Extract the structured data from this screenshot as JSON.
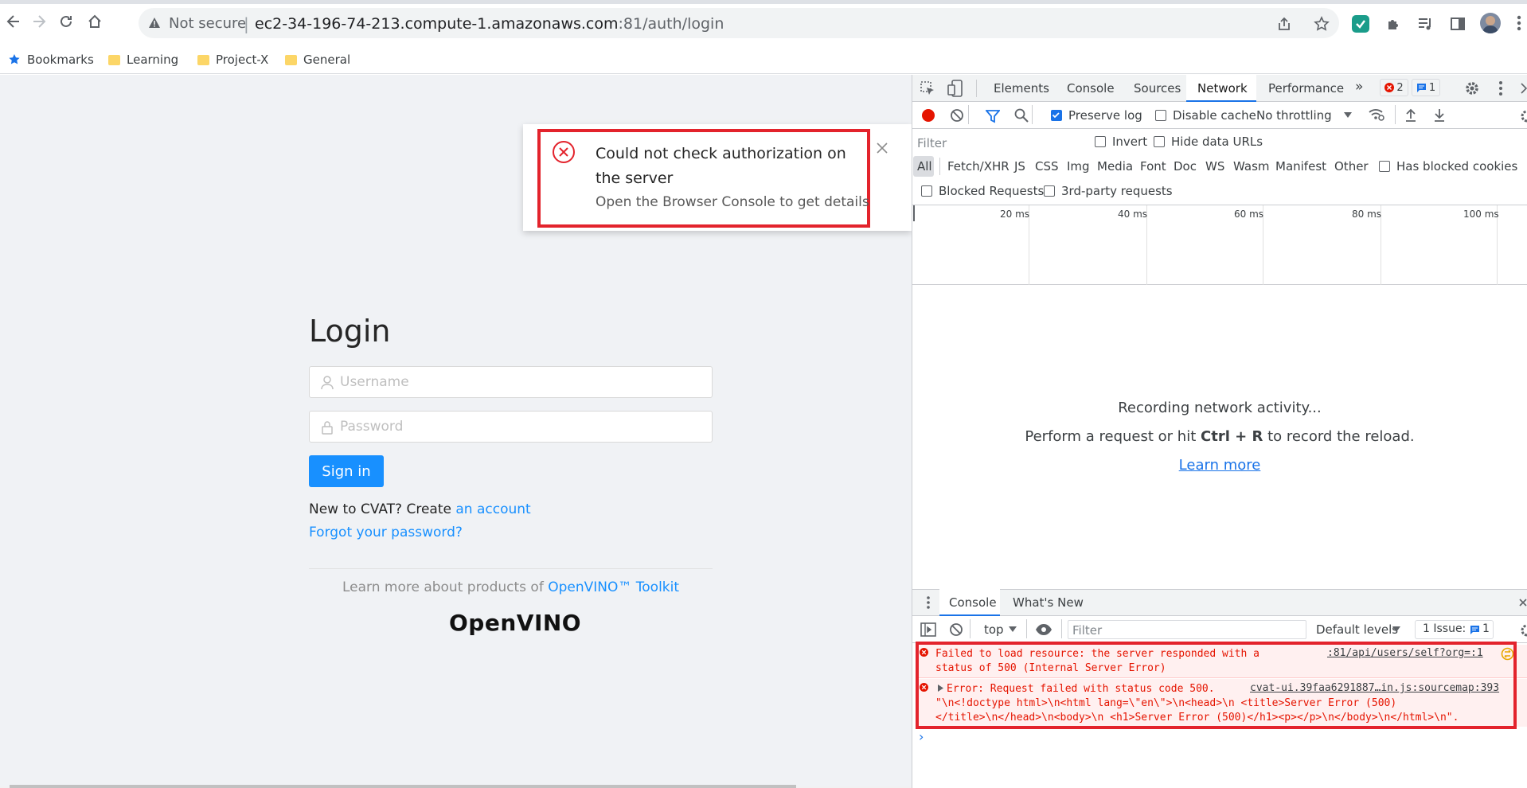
{
  "browser": {
    "security_label": "Not secure",
    "separator": "|",
    "url_host": "ec2-34-196-74-213.compute-1.amazonaws.com",
    "url_path": ":81/auth/login",
    "bookmarks": [
      "Bookmarks",
      "Learning",
      "Project-X",
      "General"
    ]
  },
  "login": {
    "title": "Login",
    "username_placeholder": "Username",
    "password_placeholder": "Password",
    "signin_label": "Sign in",
    "new_to_text": "New to CVAT? Create ",
    "account_link": "an account",
    "forgot_link": "Forgot your password?",
    "learn_more_text": "Learn more about products of ",
    "toolkit_link": "OpenVINO™ Toolkit",
    "logo_text": "OpenVINO"
  },
  "notification": {
    "title": "Could not check authorization on the server",
    "description": "Open the Browser Console to get details"
  },
  "devtools": {
    "tabs": [
      "Elements",
      "Console",
      "Sources",
      "Network",
      "Performance"
    ],
    "more": "»",
    "error_count": "2",
    "message_count": "1",
    "preserve_log": "Preserve log",
    "disable_cache": "Disable cache",
    "throttling": "No throttling",
    "filter_placeholder": "Filter",
    "invert": "Invert",
    "hide_data_urls": "Hide data URLs",
    "types": [
      "All",
      "Fetch/XHR",
      "JS",
      "CSS",
      "Img",
      "Media",
      "Font",
      "Doc",
      "WS",
      "Wasm",
      "Manifest",
      "Other"
    ],
    "has_blocked_cookies": "Has blocked cookies",
    "blocked_requests": "Blocked Requests",
    "third_party": "3rd-party requests",
    "timeline_labels": [
      "20 ms",
      "40 ms",
      "60 ms",
      "80 ms",
      "100 ms"
    ],
    "recording_line1": "Recording network activity...",
    "recording_line2_pre": "Perform a request or hit ",
    "recording_shortcut": "Ctrl + R",
    "recording_line2_post": " to record the reload.",
    "learn_more": "Learn more",
    "drawer_tabs": [
      "Console",
      "What's New"
    ],
    "context": "top",
    "console_filter_placeholder": "Filter",
    "default_levels": "Default levels",
    "issues_label": "1 Issue:",
    "issues_count": "1",
    "errors": [
      {
        "line1": "Failed to load resource: the server responded with a",
        "line2": "status of 500 (Internal Server Error)",
        "source": ":81/api/users/self?org=:1"
      },
      {
        "line1": "Error: Request failed with status code 500.",
        "line2": "\"\\n<!doctype html>\\n<html lang=\\\"en\\\">\\n<head>\\n  <title>Server Error (500)",
        "line3": "</title>\\n</head>\\n<body>\\n  <h1>Server Error (500)</h1><p></p>\\n</body>\\n</html>\\n\".",
        "source": "cvat-ui.39faa6291887…in.js:sourcemap:393"
      }
    ]
  },
  "colors": {
    "primary": "#1890ff",
    "error": "#e3232c",
    "devtools_accent": "#1a73e8"
  }
}
